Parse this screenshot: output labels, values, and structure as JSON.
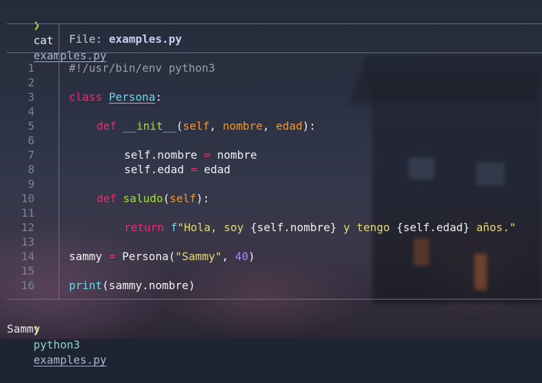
{
  "terminal": {
    "prompt_symbol": "❯",
    "command1": {
      "program": "cat",
      "argument": "examples.py"
    },
    "command2": {
      "program": "python3",
      "argument": "examples.py"
    },
    "output": "Sammy"
  },
  "viewer": {
    "file_label": "File:",
    "file_name": "examples.py",
    "line_numbers": [
      "1",
      "2",
      "3",
      "4",
      "5",
      "6",
      "7",
      "8",
      "9",
      "10",
      "11",
      "12",
      "13",
      "14",
      "15",
      "16"
    ],
    "code": {
      "l1": "#!/usr/bin/env python3",
      "l3_kw": "class",
      "l3_name": "Persona",
      "l3_end": ":",
      "l5_kw": "def",
      "l5_func": "__init__",
      "l5_open": "(",
      "l5_p1": "self",
      "l5_sep1": ", ",
      "l5_p2": "nombre",
      "l5_sep2": ", ",
      "l5_p3": "edad",
      "l5_close": "):",
      "l7_left": "self.nombre",
      "l7_op": "=",
      "l7_right": "nombre",
      "l8_left": "self.edad",
      "l8_op": "=",
      "l8_right": "edad",
      "l10_kw": "def",
      "l10_func": "saludo",
      "l10_open": "(",
      "l10_p1": "self",
      "l10_close": "):",
      "l12_kw": "return",
      "l12_prefix": "f",
      "l12_s1": "\"Hola, soy ",
      "l12_e1": "{self.nombre}",
      "l12_s2": " y tengo ",
      "l12_e2": "{self.edad}",
      "l12_s3": " años.\"",
      "l14_var": "sammy",
      "l14_op": "=",
      "l14_call": "Persona(",
      "l14_str": "\"Sammy\"",
      "l14_sep": ", ",
      "l14_num": "40",
      "l14_close": ")",
      "l16_func": "print",
      "l16_args": "(sammy.nombre)"
    }
  },
  "colors": {
    "keyword": "#f92672",
    "function": "#a6e22e",
    "class_name": "#66d9ef",
    "parameter": "#fd971f",
    "string": "#e6db74",
    "number": "#ae81ff",
    "comment": "#9a9fae",
    "prompt": "#a6e22e"
  }
}
